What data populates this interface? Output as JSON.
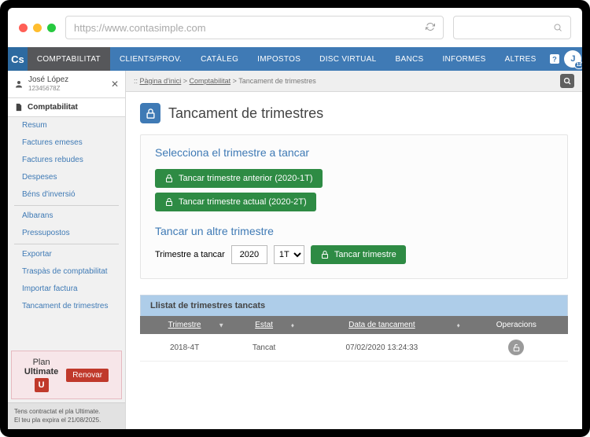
{
  "browser": {
    "url": "https://www.contasimple.com"
  },
  "nav": {
    "logo": "Cs",
    "items": [
      "COMPTABILITAT",
      "CLIENTS/PROV.",
      "CATÀLEG",
      "IMPOSTOS",
      "DISC VIRTUAL",
      "BANCS",
      "INFORMES",
      "ALTRES"
    ],
    "avatar_initial": "J",
    "avatar_badge": "12"
  },
  "user": {
    "name": "José López",
    "id": "12345678Z"
  },
  "sidebar": {
    "section": "Comptabilitat",
    "links1": [
      "Resum",
      "Factures emeses",
      "Factures rebudes",
      "Despeses",
      "Béns d'inversió"
    ],
    "links2": [
      "Albarans",
      "Pressupostos"
    ],
    "links3": [
      "Exportar",
      "Traspàs de comptabilitat",
      "Importar factura",
      "Tancament de trimestres"
    ],
    "plan_label": "Plan",
    "plan_name": "Ultimate",
    "plan_badge": "U",
    "renew": "Renovar",
    "foot1": "Tens contractat el pla Ultimate.",
    "foot2": "El teu pla expira el 21/08/2025."
  },
  "breadcrumb": {
    "home": "Pàgina d'inici",
    "sec": "Comptabilitat",
    "cur": "Tancament de trimestres"
  },
  "page": {
    "title": "Tancament de trimestres",
    "select_h": "Selecciona el trimestre a tancar",
    "btn_prev": "Tancar trimestre anterior (2020-1T)",
    "btn_cur": "Tancar trimestre actual (2020-2T)",
    "other_h": "Tancar un altre trimestre",
    "label_tri": "Trimestre a tancar",
    "year": "2020",
    "tri": "1T",
    "btn_close": "Tancar trimestre"
  },
  "table": {
    "caption": "Llistat de trimestres tancats",
    "cols": [
      "Trimestre",
      "Estat",
      "Data de tancament",
      "Operacions"
    ],
    "rows": [
      {
        "tri": "2018-4T",
        "estat": "Tancat",
        "date": "07/02/2020 13:24:33"
      }
    ]
  }
}
